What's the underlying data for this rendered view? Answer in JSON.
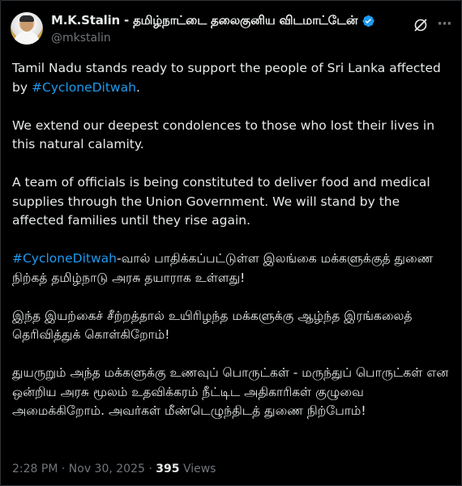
{
  "author": {
    "display_name": "M.K.Stalin - தமிழ்நாட்டை தலைகுனிய விடமாட்டேன்",
    "handle": "@mkstalin",
    "verified": true,
    "verified_color": "#1d9bf0"
  },
  "header": {
    "grok_icon": "grok-slash-circle-icon",
    "more_icon": "more-horizontal-icon",
    "more_label": "···"
  },
  "post": {
    "p1_text": "Tamil Nadu stands ready to support the people of Sri Lanka affected by ",
    "p1_hashtag": "#CycloneDitwah",
    "p1_end": ".",
    "p2_text": "We extend our deepest condolences to those who lost their lives in this natural calamity.",
    "p3_text": "A team of officials is being constituted to deliver food and medical supplies through the Union Government. We will stand by the affected families until they rise again.",
    "p4_hashtag": "#CycloneDitwah",
    "p4_text": "-வால் பாதிக்கப்பட்டுள்ள இலங்கை மக்களுக்குத் துணை நிற்கத் தமிழ்நாடு அரசு தயாராக உள்ளது!",
    "p5_text": "இந்த இயற்கைச் சீற்றத்தால் உயிரிழந்த மக்களுக்கு ஆழ்ந்த இரங்கலைத் தெரிவித்துக் கொள்கிறோம்!",
    "p6_text": "துயருறும் அந்த மக்களுக்கு உணவுப் பொருட்கள் - மருந்துப் பொருட்கள் என ஒன்றிய அரசு மூலம் உதவிக்கரம் நீட்டிட அதிகாரிகள் குழுவை அமைக்கிறோம். அவர்கள் மீண்டெழுந்திடத் துணை நிற்போம்!"
  },
  "meta": {
    "time": "2:28 PM",
    "separator1": " · ",
    "date": "Nov 30, 2025",
    "separator2": " · ",
    "views_count": "395",
    "views_label": " Views"
  },
  "colors": {
    "background": "#000000",
    "text": "#e7e9ea",
    "secondary": "#71767b",
    "link": "#1d9bf0"
  }
}
